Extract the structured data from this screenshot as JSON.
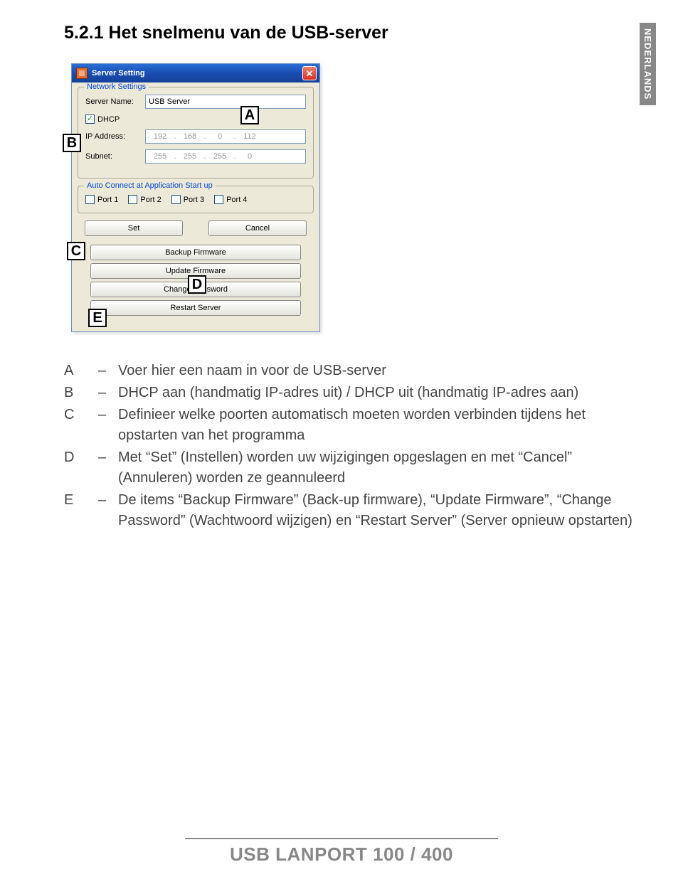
{
  "heading": "5.2.1 Het snelmenu van de USB-server",
  "sideTab": "NEDERLANDS",
  "dialog": {
    "title": "Server Setting",
    "networkLegend": "Network Settings",
    "serverNameLabel": "Server Name:",
    "serverNameValue": "USB Server",
    "dhcpLabel": "DHCP",
    "ipLabel": "IP Address:",
    "ip": {
      "o1": "192",
      "o2": "168",
      "o3": "0",
      "o4": "112"
    },
    "subnetLabel": "Subnet:",
    "subnet": {
      "o1": "255",
      "o2": "255",
      "o3": "255",
      "o4": "0"
    },
    "autoConnectLegend": "Auto Connect at Application Start up",
    "ports": [
      "Port 1",
      "Port 2",
      "Port 3",
      "Port 4"
    ],
    "setBtn": "Set",
    "cancelBtn": "Cancel",
    "backupBtn": "Backup Firmware",
    "updateBtn": "Update Firmware",
    "passwordBtn": "Change Password",
    "restartBtn": "Restart Server"
  },
  "callouts": {
    "A": "A",
    "B": "B",
    "C": "C",
    "D": "D",
    "E": "E"
  },
  "desc": {
    "A": "Voer hier een naam in voor de USB-server",
    "B": "DHCP aan (handmatig IP-adres uit) / DHCP uit (handmatig IP-adres aan)",
    "C": "Definieer welke poorten automatisch moeten worden verbinden tijdens het opstarten van het programma",
    "D": "Met “Set” (Instellen) worden uw wijzigingen opgeslagen en met “Cancel” (Annuleren) worden ze geannuleerd",
    "E": "De items “Backup Firmware” (Back-up firmware), “Update Firmware”, “Change Password” (Wachtwoord wijzigen) en “Restart Server” (Server opnieuw opstarten)"
  },
  "footer": "USB LANPORT 100 / 400",
  "dash": "–"
}
